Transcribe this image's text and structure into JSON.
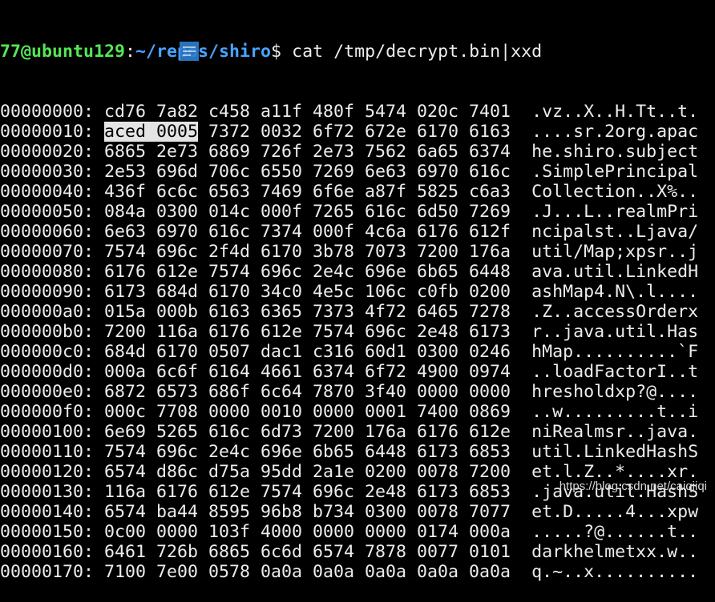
{
  "prompt": {
    "user_host": "77@ubuntu129",
    "sep": ":",
    "path": "~/repos/shiro",
    "symbol": "$ ",
    "command": "cat /tmp/decrypt.bin|xxd"
  },
  "highlight": {
    "row": 1,
    "text": "aced 0005"
  },
  "rows": [
    [
      "00000000:",
      "cd76 7a82 c458 a11f 480f 5474 020c 7401",
      ".vz..X..H.Tt..t."
    ],
    [
      "00000010:",
      "aced 0005 7372 0032 6f72 672e 6170 6163",
      "....sr.2org.apac"
    ],
    [
      "00000020:",
      "6865 2e73 6869 726f 2e73 7562 6a65 6374",
      "he.shiro.subject"
    ],
    [
      "00000030:",
      "2e53 696d 706c 6550 7269 6e63 6970 616c",
      ".SimplePrincipal"
    ],
    [
      "00000040:",
      "436f 6c6c 6563 7469 6f6e a87f 5825 c6a3",
      "Collection..X%.."
    ],
    [
      "00000050:",
      "084a 0300 014c 000f 7265 616c 6d50 7269",
      ".J...L..realmPri"
    ],
    [
      "00000060:",
      "6e63 6970 616c 7374 000f 4c6a 6176 612f",
      "ncipalst..Ljava/"
    ],
    [
      "00000070:",
      "7574 696c 2f4d 6170 3b78 7073 7200 176a",
      "util/Map;xpsr..j"
    ],
    [
      "00000080:",
      "6176 612e 7574 696c 2e4c 696e 6b65 6448",
      "ava.util.LinkedH"
    ],
    [
      "00000090:",
      "6173 684d 6170 34c0 4e5c 106c c0fb 0200",
      "ashMap4.N\\.l...."
    ],
    [
      "000000a0:",
      "015a 000b 6163 6365 7373 4f72 6465 7278",
      ".Z..accessOrderx"
    ],
    [
      "000000b0:",
      "7200 116a 6176 612e 7574 696c 2e48 6173",
      "r..java.util.Has"
    ],
    [
      "000000c0:",
      "684d 6170 0507 dac1 c316 60d1 0300 0246",
      "hMap..........`F"
    ],
    [
      "000000d0:",
      "000a 6c6f 6164 4661 6374 6f72 4900 0974",
      "..loadFactorI..t"
    ],
    [
      "000000e0:",
      "6872 6573 686f 6c64 7870 3f40 0000 0000",
      "hresholdxp?@...."
    ],
    [
      "000000f0:",
      "000c 7708 0000 0010 0000 0001 7400 0869",
      "..w.........t..i"
    ],
    [
      "00000100:",
      "6e69 5265 616c 6d73 7200 176a 6176 612e",
      "niRealmsr..java."
    ],
    [
      "00000110:",
      "7574 696c 2e4c 696e 6b65 6448 6173 6853",
      "util.LinkedHashS"
    ],
    [
      "00000120:",
      "6574 d86c d75a 95dd 2a1e 0200 0078 7200",
      "et.l.Z..*....xr."
    ],
    [
      "00000130:",
      "116a 6176 612e 7574 696c 2e48 6173 6853",
      ".java.util.HashS"
    ],
    [
      "00000140:",
      "6574 ba44 8595 96b8 b734 0300 0078 7077",
      "et.D.....4...xpw"
    ],
    [
      "00000150:",
      "0c00 0000 103f 4000 0000 0000 0174 000a",
      ".....?@......t.."
    ],
    [
      "00000160:",
      "6461 726b 6865 6c6d 6574 7878 0077 0101",
      "darkhelmetxx.w.."
    ],
    [
      "00000170:",
      "7100 7e00 0578 0a0a 0a0a 0a0a 0a0a 0a0a",
      "q.~..x.........."
    ]
  ],
  "watermark": "https://blog.csdn.net/caiqiiqi",
  "icons": {
    "ime": "input-method-icon"
  },
  "colors": {
    "user": "#55e655",
    "path": "#4aa3ff",
    "text": "#ececec",
    "highlight": "#e4e4e4"
  }
}
